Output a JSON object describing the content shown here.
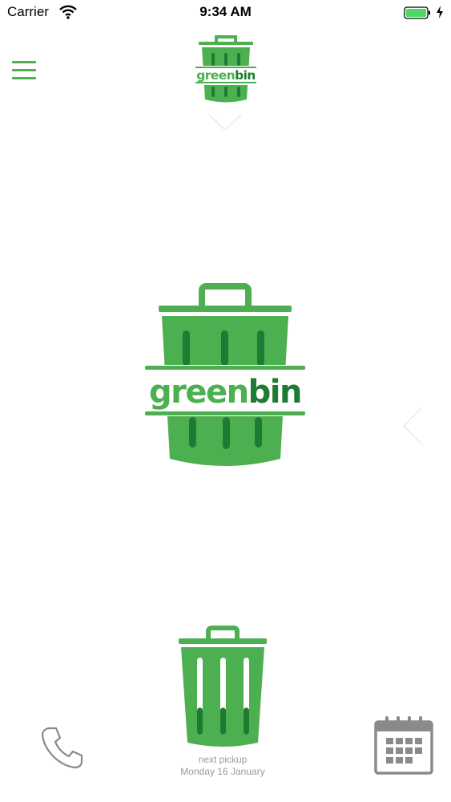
{
  "status_bar": {
    "carrier": "Carrier",
    "time": "9:34 AM",
    "wifi_icon": "wifi-icon",
    "battery_icon": "battery-charging-icon"
  },
  "brand": {
    "name_light": "green",
    "name_bold": "bin",
    "primary_color": "#4CAF50",
    "dark_color": "#1E7B34"
  },
  "navigation": {
    "menu_icon": "hamburger-menu-icon",
    "swipe_down_icon": "chevron-down-icon",
    "swipe_left_icon": "chevron-left-icon"
  },
  "pickup": {
    "label": "next pickup",
    "date": "Monday 16 January",
    "fill_level": 0.35
  },
  "footer": {
    "phone_icon": "phone-icon",
    "calendar_icon": "calendar-icon"
  }
}
